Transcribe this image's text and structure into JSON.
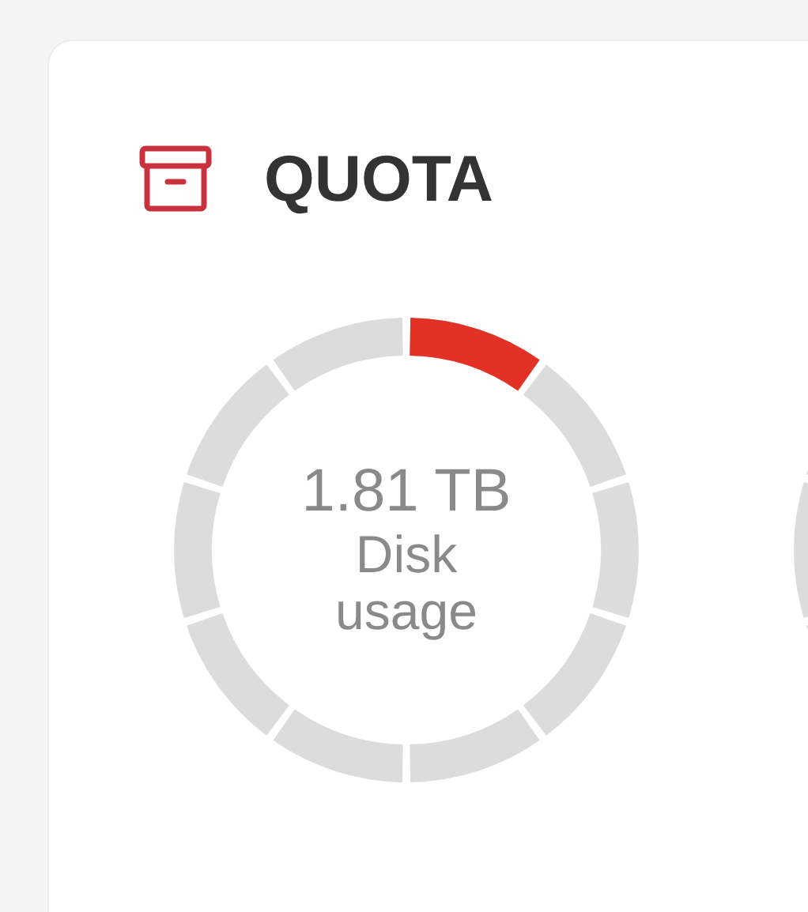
{
  "card": {
    "title": "QUOTA"
  },
  "gauge": {
    "value": "1.81 TB",
    "label": "Disk usage",
    "level": 0.1
  }
}
